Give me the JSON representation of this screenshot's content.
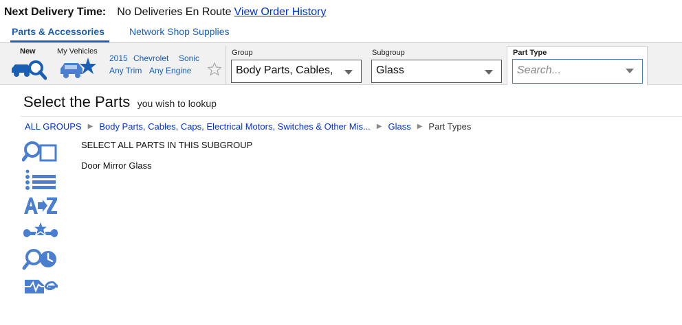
{
  "delivery": {
    "label": "Next Delivery Time:",
    "value": "No Deliveries En Route",
    "history_link": "View Order History"
  },
  "tabs": [
    {
      "label": "Parts & Accessories",
      "active": true
    },
    {
      "label": "Network Shop Supplies",
      "active": false
    }
  ],
  "toolbar": {
    "new_label": "New",
    "my_vehicles_label": "My Vehicles",
    "vehicle": {
      "year": "2015",
      "make": "Chevrolet",
      "model": "Sonic",
      "trim": "Any Trim",
      "engine": "Any Engine"
    },
    "group": {
      "label": "Group",
      "value": "Body Parts, Cables,"
    },
    "subgroup": {
      "label": "Subgroup",
      "value": "Glass"
    },
    "part_type": {
      "label": "Part Type",
      "placeholder": "Search..."
    }
  },
  "main": {
    "title": "Select the Parts",
    "subtitle": "you wish to lookup",
    "breadcrumb": [
      "ALL GROUPS",
      "Body Parts, Cables, Caps, Electrical Motors, Switches & Other Mis...",
      "Glass",
      "Part Types"
    ],
    "parts": [
      "SELECT ALL PARTS IN THIS SUBGROUP",
      "Door Mirror Glass"
    ]
  },
  "side_icons": [
    "search-lookup-icon",
    "list-view-icon",
    "a-to-z-icon",
    "favorites-tools-icon",
    "search-history-icon",
    "diagnostics-icon"
  ],
  "colors": {
    "accent": "#1a5fb4",
    "link": "#0033cc",
    "icon": "#4a7fcf",
    "toolbar_bg": "#f1f1f1"
  }
}
